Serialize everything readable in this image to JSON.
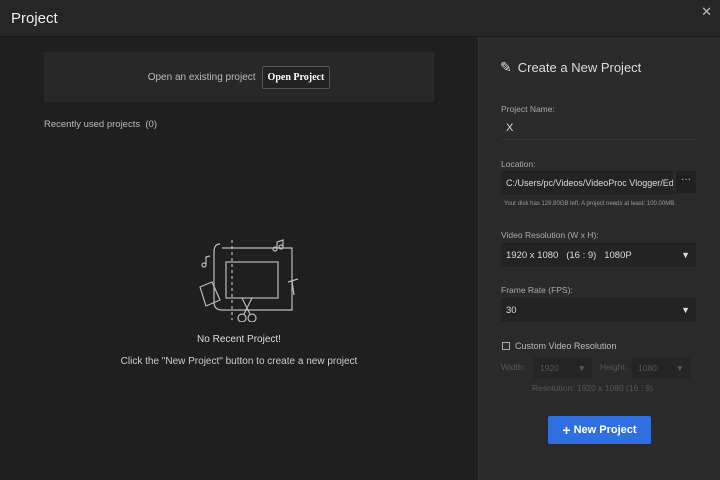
{
  "window": {
    "title": "Project",
    "close_icon": "close-icon"
  },
  "open": {
    "text": "Open an existing project",
    "button": "Open Project"
  },
  "recent": {
    "label": "Recently used projects",
    "count": "(0)",
    "empty_title": "No Recent Project!",
    "empty_hint": "Click the \"New Project\" button to create a new project"
  },
  "create": {
    "title": "Create a New Project",
    "name_label": "Project Name:",
    "name_value": "X",
    "location_label": "Location:",
    "location_value": "C:/Users/pc/Videos/VideoProc Vlogger/EditorProje",
    "browse": "···",
    "disk_info": "Your disk has 128.80GB left. A project needs at least: 100.00MB.",
    "resolution_label": "Video Resolution (W x H):",
    "resolution_value": "1920 x 1080   (16 : 9)   1080P",
    "fps_label": "Frame Rate (FPS):",
    "fps_value": "30",
    "custom_label": "Custom Video Resolution",
    "width_label": "Width:",
    "width_value": "1920",
    "height_label": "Height:",
    "height_value": "1080",
    "resolution_summary": "Resolution: 1920 x 1080  (16 : 9)",
    "new_button": "New Project"
  },
  "colors": {
    "accent": "#2f6fdf"
  }
}
